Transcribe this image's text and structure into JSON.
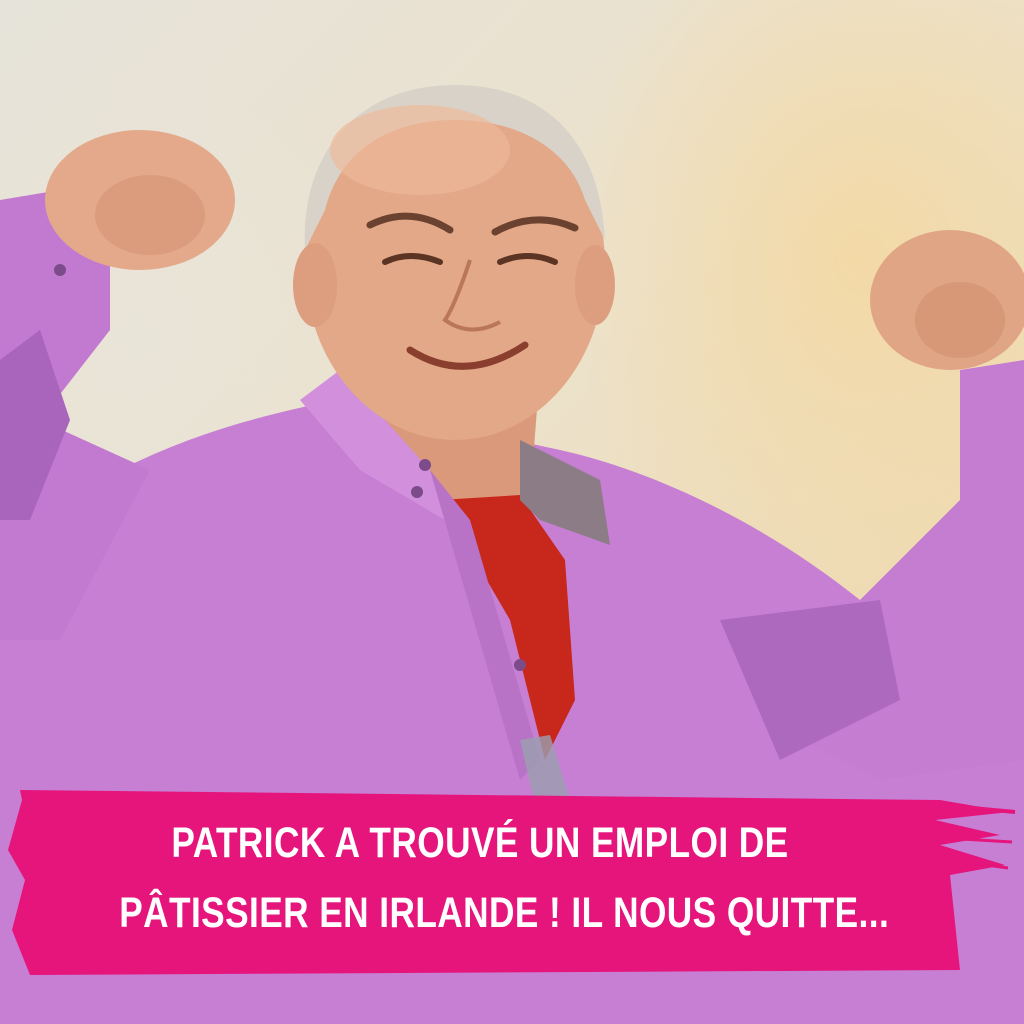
{
  "photo": {
    "subject": "smiling-man-flexing-arms",
    "colors": {
      "shirt": "#c77fd3",
      "shirt_shadow": "#9e58ae",
      "undershirt": "#c8271c",
      "skin": "#e0a585",
      "banner": "#e5157c"
    }
  },
  "caption": {
    "line1": "PATRICK A TROUVÉ UN EMPLOI DE",
    "line2": "PÂTISSIER EN IRLANDE ! IL NOUS QUITTE..."
  }
}
